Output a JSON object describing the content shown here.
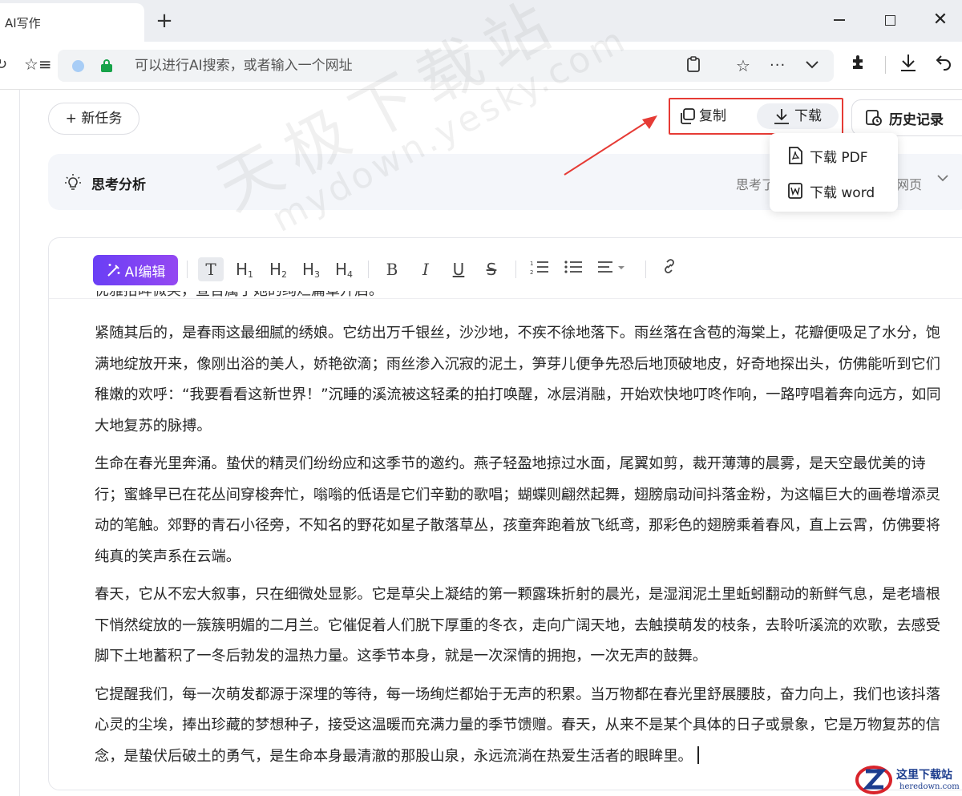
{
  "browser": {
    "tab_title": "AI写作",
    "new_tab": "+",
    "window_close": "✕",
    "address_placeholder": "可以进行AI搜索，或者输入一个网址",
    "nav_refresh_icon": "↻",
    "fav_icon": "☆≡",
    "clipboard_icon": "📋",
    "star_icon": "☆",
    "more_icon": "···",
    "chevron_icon": "⌄",
    "extensions_icon": "✱",
    "download_icon": "⤓",
    "back_icon": "↶"
  },
  "page": {
    "new_task": "+ 新任务",
    "copy_label": "复制",
    "download_label": "下载",
    "history_label": "历史记录",
    "thinking_title": "思考分析",
    "thinking_meta_a": "思考了",
    "thinking_meta_b": "网页",
    "download_menu": {
      "pdf": "下载 PDF",
      "word": "下载 word"
    },
    "highlight_color": "#e63b35"
  },
  "toolbar": {
    "ai_edit": "AI编辑",
    "text": "T",
    "h1": "H",
    "h1_sub": "1",
    "h2": "H",
    "h2_sub": "2",
    "h3": "H",
    "h3_sub": "3",
    "h4": "H",
    "h4_sub": "4",
    "bold": "B",
    "italic": "I",
    "underline": "U",
    "strike": "S",
    "ordered_list": "⅓≡",
    "bullet_list": "☰",
    "align": "≡▾",
    "link": "🔗",
    "accent_color": "#7c4af3"
  },
  "editor": {
    "clipped_line": "优雅抬眸微笑，宣告属于她的绚烂篇章开启。",
    "paragraphs": [
      "紧随其后的，是春雨这最细腻的绣娘。它纺出万千银丝，沙沙地，不疾不徐地落下。雨丝落在含苞的海棠上，花瓣便吸足了水分，饱满地绽放开来，像刚出浴的美人，娇艳欲滴；雨丝渗入沉寂的泥土，笋芽儿便争先恐后地顶破地皮，好奇地探出头，仿佛能听到它们稚嫩的欢呼：“我要看看这新世界！”沉睡的溪流被这轻柔的拍打唤醒，冰层消融，开始欢快地叮咚作响，一路哼唱着奔向远方，如同大地复苏的脉搏。",
      "生命在春光里奔涌。蛰伏的精灵们纷纷应和这季节的邀约。燕子轻盈地掠过水面，尾翼如剪，裁开薄薄的晨雾，是天空最优美的诗行；蜜蜂早已在花丛间穿梭奔忙，嗡嗡的低语是它们辛勤的歌唱；蝴蝶则翩然起舞，翅膀扇动间抖落金粉，为这幅巨大的画卷增添灵动的笔触。郊野的青石小径旁，不知名的野花如星子散落草丛，孩童奔跑着放飞纸鸢，那彩色的翅膀乘着春风，直上云霄，仿佛要将纯真的笑声系在云端。",
      "春天，它从不宏大叙事，只在细微处显影。它是草尖上凝结的第一颗露珠折射的晨光，是湿润泥土里蚯蚓翻动的新鲜气息，是老墙根下悄然绽放的一簇簇明媚的二月兰。它催促着人们脱下厚重的冬衣，走向广阔天地，去触摸萌发的枝条，去聆听溪流的欢歌，去感受脚下土地蓄积了一冬后勃发的温热力量。这季节本身，就是一次深情的拥抱，一次无声的鼓舞。",
      "它提醒我们，每一次萌发都源于深埋的等待，每一场绚烂都始于无声的积累。当万物都在春光里舒展腰肢，奋力向上，我们也该抖落心灵的尘埃，捧出珍藏的梦想种子，接受这温暖而充满力量的季节馈赠。春天，从来不是某个具体的日子或景象，它是万物复苏的信念，是蛰伏后破土的勇气，是生命本身最清澈的那股山泉，永远流淌在热爱生活者的眼眸里。"
    ]
  },
  "overlays": {
    "watermark_cn": "天极下载站",
    "watermark_en": "mydown.yesky.com",
    "logo_cn": "这里下载站",
    "logo_en": "heredown.com",
    "logo_color": "#1c3d8e"
  }
}
